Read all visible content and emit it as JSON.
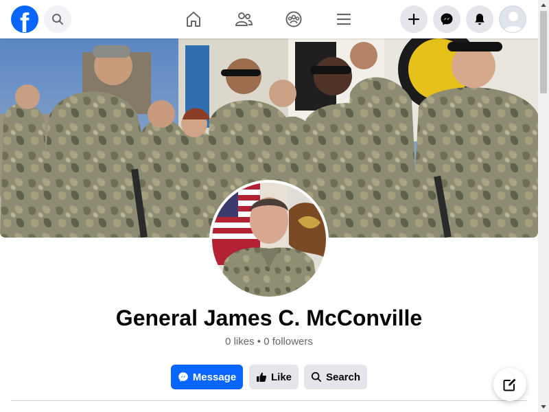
{
  "topbar": {
    "logo_letter": "f",
    "icons": {
      "logo": "facebook-logo-icon",
      "search": "search-icon",
      "home": "home-icon",
      "friends": "friends-icon",
      "groups": "groups-icon",
      "menu": "hamburger-menu-icon",
      "create": "plus-icon",
      "messenger": "messenger-icon",
      "notifications": "bell-icon",
      "account": "account-avatar-icon"
    }
  },
  "profile": {
    "name": "General James C. McConville",
    "stats": "0 likes • 0 followers",
    "cover_description": "Soldiers in camouflage uniforms standing in a line",
    "profile_picture_description": "Official portrait in uniform in front of flags"
  },
  "actions": {
    "message_label": "Message",
    "like_label": "Like",
    "search_label": "Search"
  },
  "colors": {
    "brand_blue": "#0866ff",
    "button_gray": "#e4e6eb",
    "secondary_text": "#65676b"
  }
}
